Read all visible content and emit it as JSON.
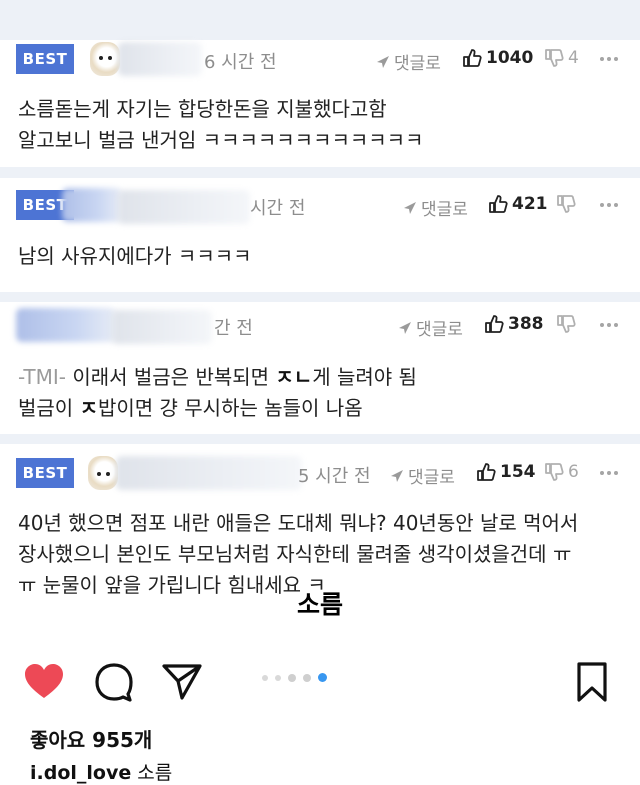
{
  "comments": [
    {
      "badge": "BEST",
      "time": "6 시간 전",
      "reply_label": "댓글로",
      "likes": "1040",
      "dislikes": "4",
      "lines": [
        "소름돋는게 자기는 합당한돈을 지불했다고함",
        "알고보니 벌금 낸거임 ㅋㅋㅋㅋㅋㅋㅋㅋㅋㅋㅋㅋ"
      ]
    },
    {
      "badge": "BEST",
      "time": "시간 전",
      "reply_label": "댓글로",
      "likes": "421",
      "dislikes": "",
      "lines": [
        "남의 사유지에다가 ㅋㅋㅋㅋ"
      ]
    },
    {
      "badge": "",
      "time": "간 전",
      "reply_label": "댓글로",
      "likes": "388",
      "dislikes": "",
      "tmi": "-TMI-",
      "line1_pre": " 이래서 벌금은 반복되면 ",
      "line1_bold": "ㅈㄴ",
      "line1_post": "게 늘려야 됨",
      "line2_pre": "벌금이 ",
      "line2_bold": "ㅈ",
      "line2_post": "밥이면 걍 무시하는 놈들이 나옴"
    },
    {
      "badge": "BEST",
      "time": "5 시간 전",
      "reply_label": "댓글로",
      "likes": "154",
      "dislikes": "6",
      "lines": [
        "40년 했으면 점포 내란 애들은 도대체 뭐냐? 40년동안 날로 먹어서",
        "장사했으니 본인도 부모님처럼 자식한테 물려줄 생각이셨을건데 ㅠ",
        "ㅠ 눈물이 앞을 가립니다 힘내세요 ㅋ"
      ]
    }
  ],
  "overlay_caption": "소름",
  "instagram": {
    "likes_text": "좋아요 955개",
    "username": "i.dol_love",
    "caption": "소름",
    "icons": [
      "heart-icon",
      "comment-icon",
      "share-icon",
      "bookmark-icon"
    ],
    "colors": {
      "heart": "#ed4956",
      "active_dot": "#3897f0",
      "best_badge": "#4d74d4"
    }
  }
}
